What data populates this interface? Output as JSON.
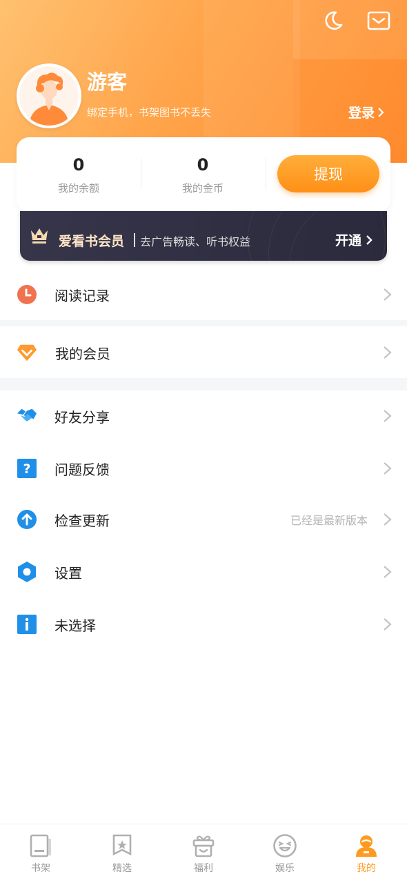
{
  "colors": {
    "accent": "#ff9a20",
    "header_start": "#ffc170",
    "header_end": "#ff8d2e",
    "vip_bg": "#2b2a3c"
  },
  "header": {
    "top_icons": [
      "moon-icon",
      "mail-icon"
    ],
    "username": "游客",
    "subtitle": "绑定手机，书架图书不丢失",
    "login_label": "登录"
  },
  "stats": {
    "balance": {
      "value": "0",
      "label": "我的余额"
    },
    "coins": {
      "value": "0",
      "label": "我的金币"
    },
    "withdraw_label": "提现"
  },
  "vip": {
    "title": "爱看书会员",
    "description": "去广告畅读、听书权益",
    "action": "开通"
  },
  "menu": [
    {
      "label": "阅读记录",
      "icon": "clock-icon",
      "extra": ""
    },
    {
      "label": "我的会员",
      "icon": "diamond-icon",
      "extra": ""
    },
    {
      "label": "好友分享",
      "icon": "handshake-icon",
      "extra": ""
    },
    {
      "label": "问题反馈",
      "icon": "question-icon",
      "extra": ""
    },
    {
      "label": "检查更新",
      "icon": "upload-icon",
      "extra": "已经是最新版本"
    },
    {
      "label": "设置",
      "icon": "settings-icon",
      "extra": ""
    },
    {
      "label": "未选择",
      "icon": "info-icon",
      "extra": ""
    }
  ],
  "tabbar": [
    {
      "label": "书架",
      "icon": "bookshelf-icon"
    },
    {
      "label": "精选",
      "icon": "featured-icon"
    },
    {
      "label": "福利",
      "icon": "gift-icon"
    },
    {
      "label": "娱乐",
      "icon": "smile-icon"
    },
    {
      "label": "我的",
      "icon": "profile-icon",
      "active": true
    }
  ]
}
